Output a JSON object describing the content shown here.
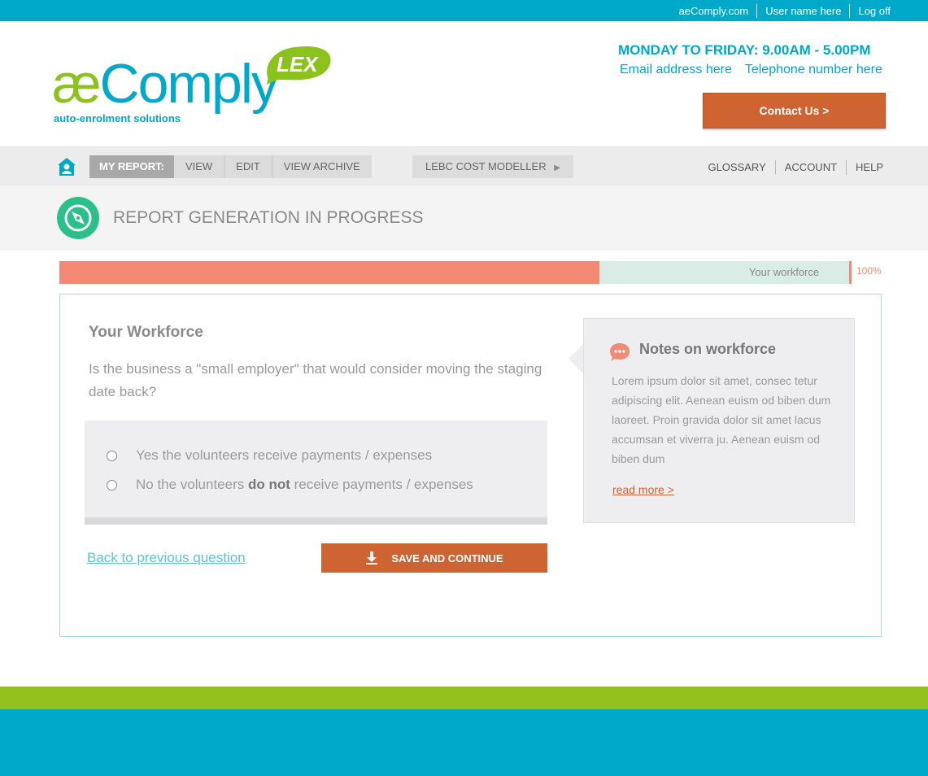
{
  "topbar": {
    "links": [
      "aeComply.com",
      "User name here",
      "Log off"
    ]
  },
  "header": {
    "logo_ae": "æ",
    "logo_comply": "Comply",
    "logo_badge": "LEX",
    "logo_tagline": "auto-enrolment solutions",
    "hours": "MONDAY TO FRIDAY: 9.00AM - 5.00PM",
    "email": "Email address here",
    "phone": "Telephone number here",
    "contact_button": "Contact Us >"
  },
  "nav": {
    "my_report_label": "MY REPORT:",
    "report_tabs": [
      "VIEW",
      "EDIT",
      "VIEW ARCHIVE"
    ],
    "lebc_label": "LEBC COST MODELLER",
    "right_links": [
      "GLOSSARY",
      "ACCOUNT",
      "HELP"
    ]
  },
  "page": {
    "title": "REPORT GENERATION IN PROGRESS"
  },
  "progress": {
    "fraction_filled": 0.683,
    "label": "Your workforce",
    "percent_text": "100%"
  },
  "question": {
    "heading": "Your Workforce",
    "text": "Is the business a \"small employer\" that would consider moving the staging date back?",
    "option_yes": "Yes the volunteers receive payments / expenses",
    "option_no_pre": "No the volunteers ",
    "option_no_bold": "do not",
    "option_no_post": " receive payments / expenses",
    "back_link": "Back to previous question",
    "save_button": "SAVE AND CONTINUE"
  },
  "notes": {
    "title": "Notes on workforce",
    "body": "Lorem ipsum dolor sit amet, consec tetur adipiscing elit. Aenean euism od biben dum laoreet. Proin gravida dolor sit amet lacus accumsan et viverra ju. Aenean euism od biben dum",
    "read_more": "read more >"
  },
  "colors": {
    "brand_blue": "#00a9c9",
    "brand_green": "#95c11f",
    "accent_orange": "#cd6432",
    "progress_fill": "#f28a76",
    "progress_track": "#d9ede6"
  }
}
